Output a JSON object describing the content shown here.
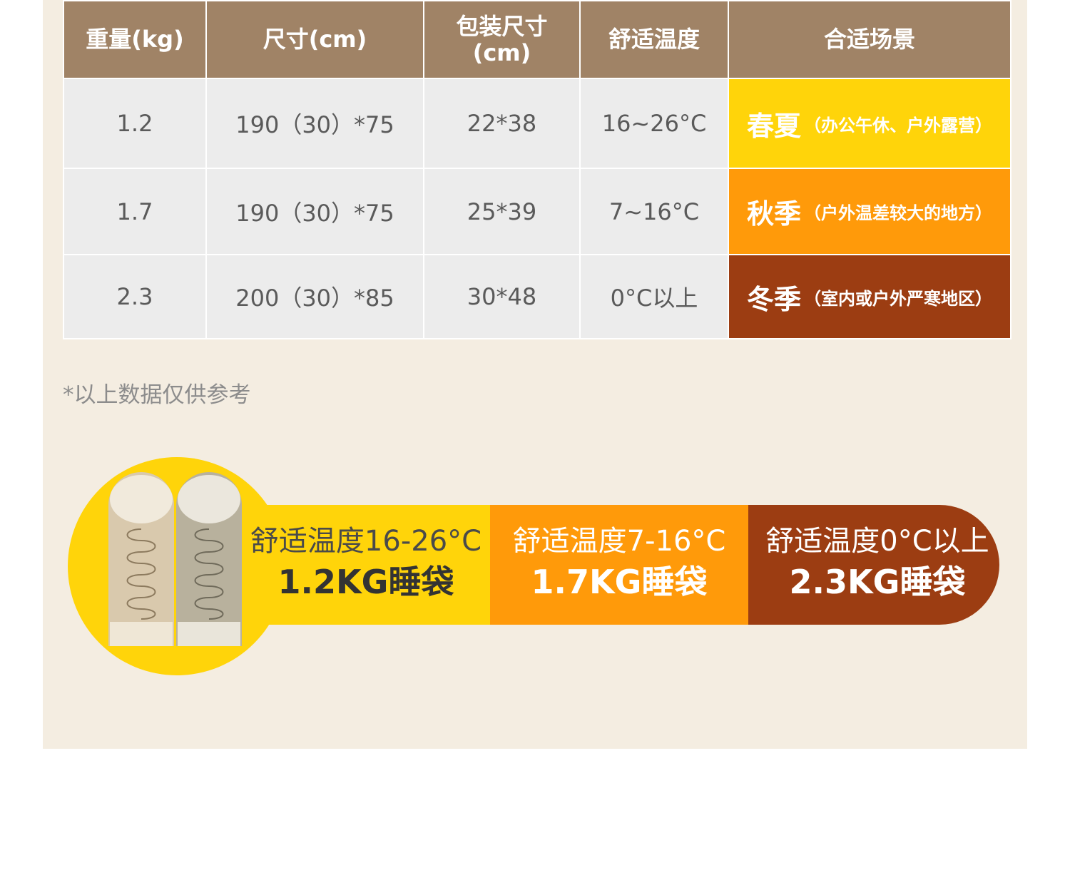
{
  "table": {
    "headers": [
      "重量(kg)",
      "尺寸(cm)",
      "包装尺寸\n(cm)",
      "舒适温度",
      "合适场景"
    ],
    "header_pack_line1": "包装尺寸",
    "header_pack_line2": "(cm)",
    "rows": [
      {
        "weight": "1.2",
        "size": "190（30）*75",
        "pack": "22*38",
        "temp": "16~26°C",
        "season": "春夏",
        "scene": "（办公午休、户外露营）",
        "color": "#ffd40a"
      },
      {
        "weight": "1.7",
        "size": "190（30）*75",
        "pack": "25*39",
        "temp": "7~16°C",
        "season": "秋季",
        "scene": "（户外温差较大的地方）",
        "color": "#ff9a0a"
      },
      {
        "weight": "2.3",
        "size": "200（30）*85",
        "pack": "30*48",
        "temp": "0°C以上",
        "season": "冬季",
        "scene": "（室内或户外严寒地区）",
        "color": "#9c3d12"
      }
    ]
  },
  "note": "*以上数据仅供参考",
  "comparison": [
    {
      "temp": "舒适温度16-26°C",
      "weight": "1.2KG睡袋",
      "color": "#ffd40a"
    },
    {
      "temp": "舒适温度7-16°C",
      "weight": "1.7KG睡袋",
      "color": "#ff9a0a"
    },
    {
      "temp": "舒适温度0°C以上",
      "weight": "2.3KG睡袋",
      "color": "#9c3d12"
    }
  ],
  "colors": {
    "header_bg": "#a08366",
    "cell_bg": "#ececec",
    "panel_bg": "#f4ede1"
  },
  "images": [
    "sleeping-bag-beige",
    "sleeping-bag-gray"
  ]
}
